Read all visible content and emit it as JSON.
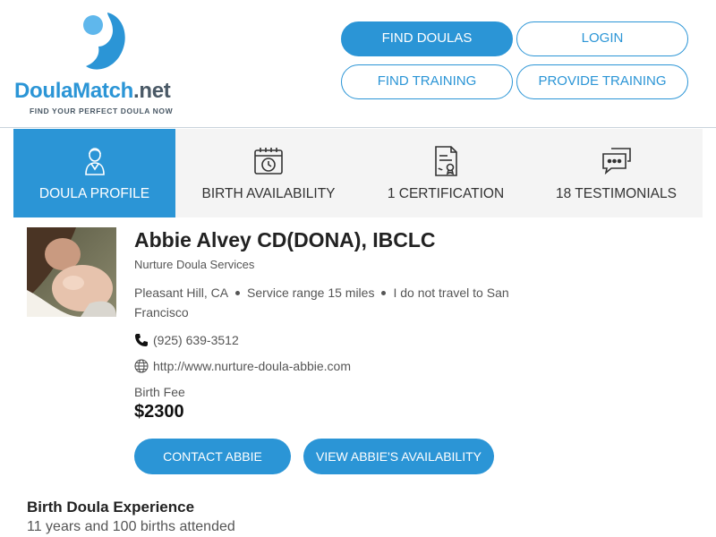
{
  "logo": {
    "word_doula": "Doula",
    "word_match": "Match",
    "word_net": ".net",
    "tagline": "FIND YOUR PERFECT DOULA NOW"
  },
  "nav": {
    "find_doulas": "FIND DOULAS",
    "login": "LOGIN",
    "find_training": "FIND TRAINING",
    "provide_training": "PROVIDE TRAINING"
  },
  "tabs": [
    {
      "label": "DOULA PROFILE",
      "icon": "doula-person-icon",
      "active": true
    },
    {
      "label": "BIRTH AVAILABILITY",
      "icon": "calendar-clock-icon",
      "active": false
    },
    {
      "label": "1 CERTIFICATION",
      "icon": "certificate-icon",
      "active": false
    },
    {
      "label": "18 TESTIMONIALS",
      "icon": "chat-bubbles-icon",
      "active": false
    }
  ],
  "profile": {
    "name": "Abbie Alvey CD(DONA), IBCLC",
    "agency": "Nurture Doula Services",
    "location": "Pleasant Hill, CA",
    "service_range": "Service range 15 miles",
    "travel_note": "I do not travel to San Francisco",
    "phone": "(925) 639-3512",
    "website": "http://www.nurture-doula-abbie.com",
    "fee_label": "Birth Fee",
    "fee_value": "$2300"
  },
  "actions": {
    "contact": "CONTACT ABBIE",
    "availability": "VIEW ABBIE'S AVAILABILITY"
  },
  "experience": {
    "title": "Birth Doula Experience",
    "text": "11 years and 100 births attended"
  },
  "colors": {
    "brand_blue": "#2b95d6",
    "text_gray": "#555555",
    "tab_bg": "#f4f4f4"
  }
}
